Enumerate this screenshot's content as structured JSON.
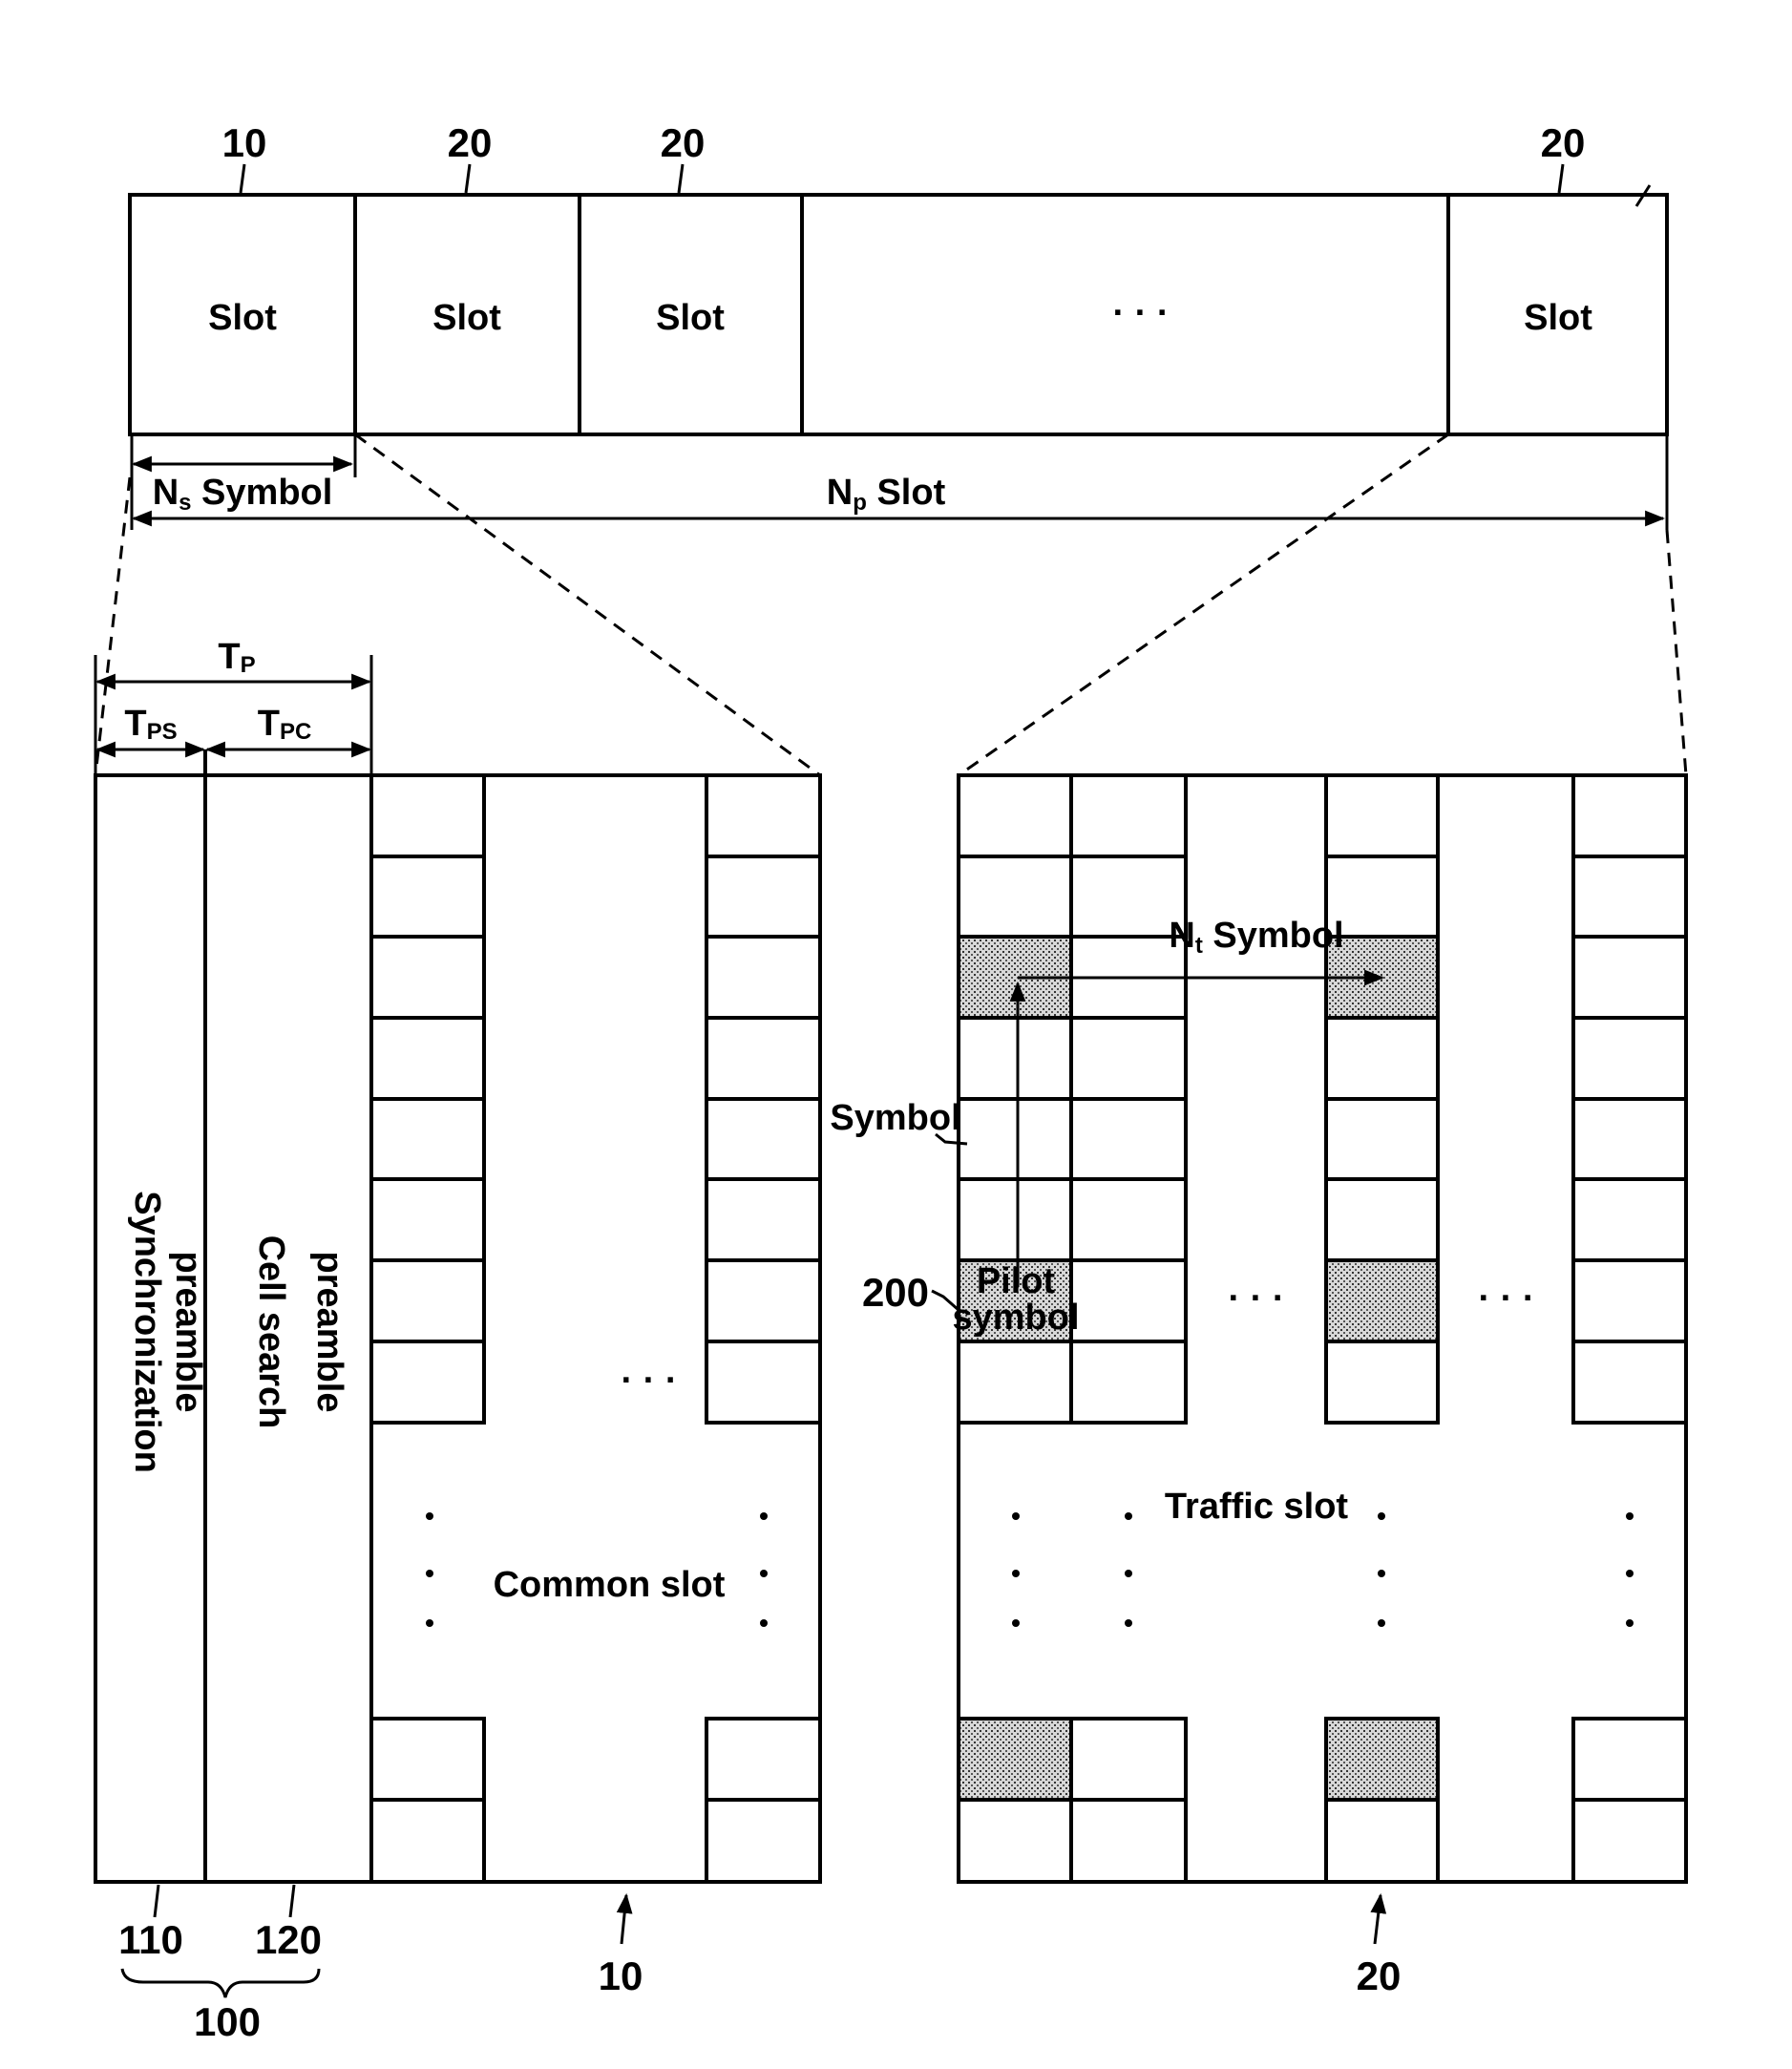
{
  "figure": {
    "top_bar": {
      "slots": [
        {
          "ref": "10",
          "label": "Slot"
        },
        {
          "ref": "20",
          "label": "Slot"
        },
        {
          "ref": "20",
          "label": "Slot"
        },
        {
          "ref": "",
          "label": "· · ·"
        },
        {
          "ref": "20",
          "label": "Slot"
        }
      ],
      "ns_label": "N",
      "ns_sub": "s",
      "ns_suffix": " Symbol",
      "np_label": "N",
      "np_sub": "p",
      "np_suffix": " Slot"
    },
    "left_panel": {
      "tp_label": "T",
      "tp_sub": "P",
      "tps_label": "T",
      "tps_sub": "PS",
      "tpc_label": "T",
      "tpc_sub": "PC",
      "sync_line1": "Synchronization",
      "sync_line2": "preamble",
      "cell_line1": "Cell search",
      "cell_line2": "preamble",
      "common_slot_label": "Common slot",
      "ellipsis": "· · ·",
      "ref_110": "110",
      "ref_120": "120",
      "ref_100": "100",
      "ref_10": "10"
    },
    "right_panel": {
      "nt_label": "N",
      "nt_sub": "t",
      "nt_suffix": " Symbol",
      "symbol_label": "Symbol",
      "pilot_line1": "Pilot",
      "pilot_line2": "symbol",
      "ref_200": "200",
      "traffic_slot_label": "Traffic slot",
      "ellipsis": "· · ·",
      "ref_20": "20"
    }
  }
}
